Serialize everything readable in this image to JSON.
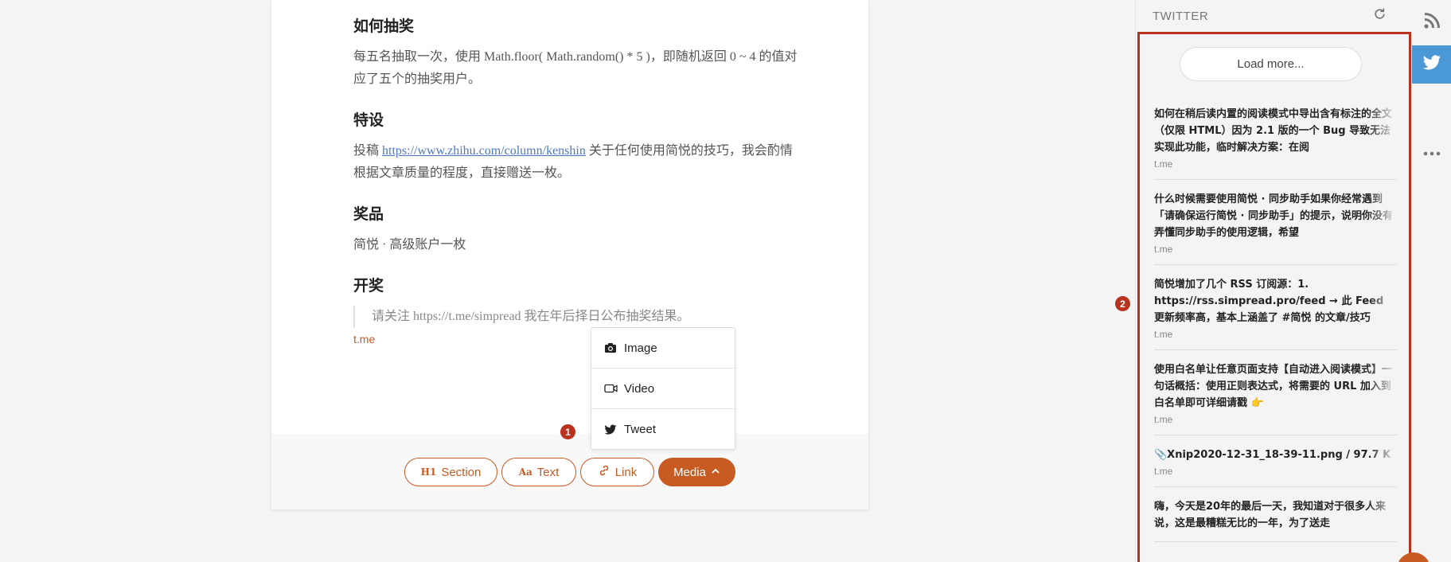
{
  "article": {
    "sections": [
      {
        "heading": "如何抽奖",
        "text": "每五名抽取一次，使用 Math.floor( Math.random() * 5 )，即随机返回 0 ~ 4 的值对应了五个的抽奖用户。"
      },
      {
        "heading": "特设",
        "text_before": "投稿 ",
        "link": "https://www.zhihu.com/column/kenshin",
        "text_after": " 关于任何使用简悦的技巧，我会酌情根据文章质量的程度，直接赠送一枚。"
      },
      {
        "heading": "奖品",
        "text": "简悦 · 高级账户一枚"
      },
      {
        "heading": "开奖",
        "quote": "请关注 https://t.me/simpread 我在年后择日公布抽奖结果。"
      }
    ],
    "source": "t.me"
  },
  "toolbar": {
    "section_icon": "H1",
    "section_label": "Section",
    "text_icon": "Aa",
    "text_label": "Text",
    "link_label": "Link",
    "media_label": "Media"
  },
  "media_menu": {
    "items": [
      {
        "label": "Image",
        "icon": "camera-icon"
      },
      {
        "label": "Video",
        "icon": "video-icon"
      },
      {
        "label": "Tweet",
        "icon": "twitter-bird-icon"
      }
    ]
  },
  "badges": {
    "one": "1",
    "two": "2"
  },
  "sidebar": {
    "title": "TWITTER",
    "load_more": "Load more...",
    "items": [
      {
        "text": "如何在稍后读内置的阅读模式中导出含有标注的全文（仅限 HTML）因为 2.1 版的一个 Bug 导致无法实现此功能，临时解决方案：在阅",
        "source": "t.me"
      },
      {
        "text": "什么时候需要使用简悦 · 同步助手如果你经常遇到「请确保运行简悦 · 同步助手」的提示，说明你没有弄懂同步助手的使用逻辑，希望",
        "source": "t.me"
      },
      {
        "text": "简悦增加了几个 RSS 订阅源：1. https://rss.simpread.pro/feed → 此 Feed 更新频率高，基本上涵盖了 #简悦 的文章/技巧",
        "source": "t.me"
      },
      {
        "text": "使用白名单让任意页面支持【自动进入阅读模式】一句话概括：使用正则表达式，将需要的 URL 加入到白名单即可详细请戳 👉",
        "source": "t.me"
      },
      {
        "text": "📎Xnip2020-12-31_18-39-11.png / 97.7 K",
        "source": "t.me"
      },
      {
        "text": "嗨，今天是20年的最后一天，我知道对于很多人来说，这是最糟糕无比的一年，为了送走",
        "source": ""
      }
    ]
  },
  "colors": {
    "accent": "#c75b21",
    "badge": "#b8321f",
    "twitter": "#4a98d6",
    "link": "#4e78c4"
  }
}
